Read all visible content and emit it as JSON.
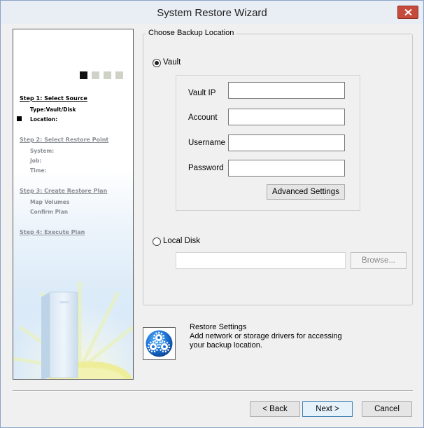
{
  "window": {
    "title": "System Restore Wizard"
  },
  "sidebar": {
    "steps": [
      {
        "label": "Step 1: Select Source",
        "details": [
          "Type:Vault/Disk",
          "Location:"
        ]
      },
      {
        "label": "Step 2: Select Restore Point",
        "details": [
          "System:",
          "Job:",
          "Time:"
        ]
      },
      {
        "label": "Step 3: Create Restore Plan",
        "details": [
          "Map Volumes",
          "Confirm Plan"
        ]
      },
      {
        "label": "Step 4: Execute Plan",
        "details": []
      }
    ],
    "current_step": 1,
    "progress_total": 4
  },
  "backup_location": {
    "group_title": "Choose Backup Location",
    "vault": {
      "label": "Vault",
      "selected": true,
      "fields": [
        {
          "label": "Vault IP",
          "value": ""
        },
        {
          "label": "Account",
          "value": ""
        },
        {
          "label": "Username",
          "value": ""
        },
        {
          "label": "Password",
          "value": ""
        }
      ],
      "advanced_button": "Advanced Settings"
    },
    "local_disk": {
      "label": "Local Disk",
      "selected": false,
      "path_value": "",
      "browse_button": "Browse..."
    }
  },
  "restore_settings": {
    "title": "Restore Settings",
    "description": "Add network or storage drivers for accessing your backup location."
  },
  "footer": {
    "back_button": "< Back",
    "next_button": "Next >",
    "cancel_button": "Cancel"
  },
  "icons": {
    "close": "close-icon",
    "settings": "gears-icon",
    "sidebar_art": "server-sunrise-illustration"
  }
}
